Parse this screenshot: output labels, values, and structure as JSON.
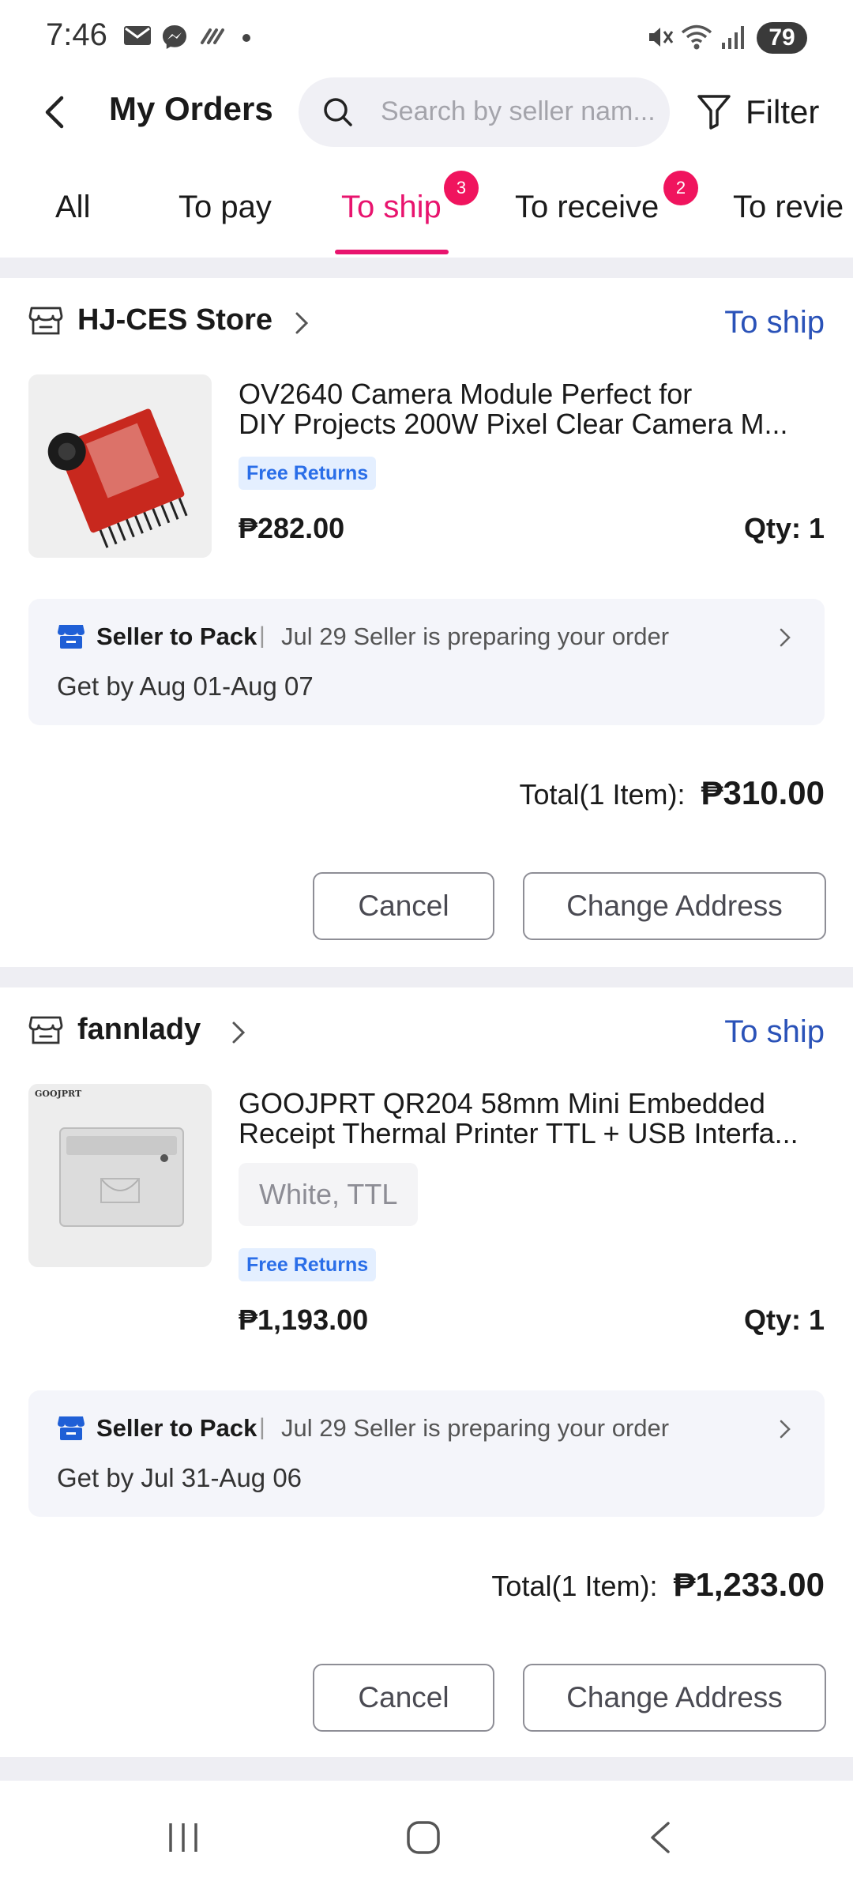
{
  "status_bar": {
    "time": "7:46",
    "icons": [
      "mail-icon",
      "messenger-icon",
      "signal-slash-icon",
      "dot-icon",
      "mute-icon",
      "wifi-icon",
      "cell-signal-icon"
    ],
    "battery": "79"
  },
  "header": {
    "title": "My Orders",
    "search_placeholder": "Search by seller nam...",
    "filter_label": "Filter"
  },
  "tabs": [
    {
      "label": "All"
    },
    {
      "label": "To pay"
    },
    {
      "label": "To ship",
      "badge": "3",
      "active": true
    },
    {
      "label": "To receive",
      "badge": "2"
    },
    {
      "label": "To revie"
    }
  ],
  "colors": {
    "accent": "#e8146e",
    "status_blue": "#2a52b8",
    "badge": "#f0145e"
  },
  "orders": [
    {
      "store": "HJ-CES Store",
      "status": "To ship",
      "product_title_line1": "OV2640 Camera Module Perfect for",
      "product_title_line2": "DIY Projects 200W Pixel Clear Camera M...",
      "free_returns": "Free Returns",
      "price": "₱282.00",
      "qty": "Qty: 1",
      "pack_label": "Seller to Pack",
      "pack_sep": "|",
      "pack_message": "Jul 29 Seller is preparing your order",
      "get_by": "Get by Aug 01-Aug 07",
      "total_label": "Total(1 Item):",
      "total_value": "₱310.00",
      "cancel_label": "Cancel",
      "change_address_label": "Change Address"
    },
    {
      "store": "fannlady",
      "status": "To ship",
      "product_title_line1": "GOOJPRT QR204 58mm Mini Embedded",
      "product_title_line2": "Receipt Thermal Printer TTL + USB Interfa...",
      "variant": "White,  TTL",
      "thumb_brand": "GOOJPRT",
      "free_returns": "Free Returns",
      "price": "₱1,193.00",
      "qty": "Qty: 1",
      "pack_label": "Seller to Pack",
      "pack_sep": "|",
      "pack_message": "Jul 29 Seller is preparing your order",
      "get_by": "Get by Jul 31-Aug 06",
      "total_label": "Total(1 Item):",
      "total_value": "₱1,233.00",
      "cancel_label": "Cancel",
      "change_address_label": "Change Address"
    }
  ],
  "nav_bar": {
    "icons": [
      "recent-apps-icon",
      "home-icon",
      "system-back-icon"
    ]
  }
}
